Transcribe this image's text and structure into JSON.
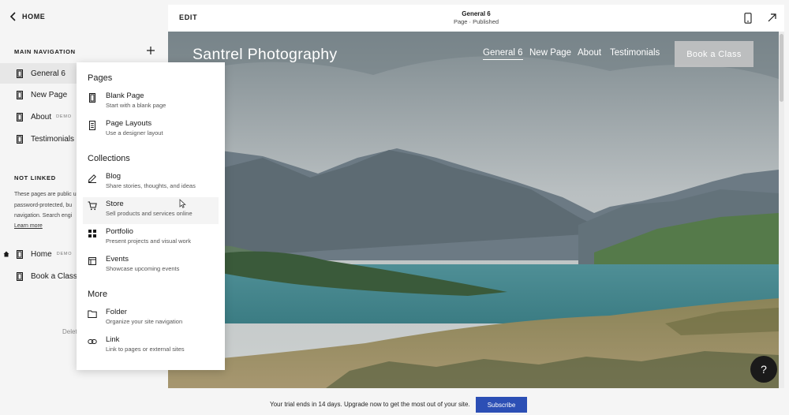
{
  "sidebar": {
    "back_label": "HOME",
    "main_nav_heading": "MAIN NAVIGATION",
    "main_items": [
      {
        "label": "General 6",
        "demo": ""
      },
      {
        "label": "New Page",
        "demo": ""
      },
      {
        "label": "About",
        "demo": "DEMO"
      },
      {
        "label": "Testimonials",
        "demo": ""
      }
    ],
    "not_linked_heading": "NOT LINKED",
    "not_linked_lines": [
      "These pages are public u",
      "password-protected, bu",
      "navigation. Search engi"
    ],
    "learn_more": "Learn more",
    "unlinked_items": [
      {
        "label": "Home",
        "demo": "DEMO"
      },
      {
        "label": "Book a Class",
        "demo": ""
      }
    ],
    "deleted_label": "Delet"
  },
  "dropdown": {
    "sections": [
      {
        "heading": "Pages",
        "items": [
          {
            "title": "Blank Page",
            "desc": "Start with a blank page",
            "icon": "page-icon"
          },
          {
            "title": "Page Layouts",
            "desc": "Use a designer layout",
            "icon": "layout-icon"
          }
        ]
      },
      {
        "heading": "Collections",
        "items": [
          {
            "title": "Blog",
            "desc": "Share stories, thoughts, and ideas",
            "icon": "pen-icon"
          },
          {
            "title": "Store",
            "desc": "Sell products and services online",
            "icon": "cart-icon"
          },
          {
            "title": "Portfolio",
            "desc": "Present projects and visual work",
            "icon": "grid-icon"
          },
          {
            "title": "Events",
            "desc": "Showcase upcoming events",
            "icon": "calendar-icon"
          }
        ]
      },
      {
        "heading": "More",
        "items": [
          {
            "title": "Folder",
            "desc": "Organize your site navigation",
            "icon": "folder-icon"
          },
          {
            "title": "Link",
            "desc": "Link to pages or external sites",
            "icon": "link-icon"
          }
        ]
      }
    ]
  },
  "topbar": {
    "edit_label": "EDIT",
    "page_title": "General 6",
    "page_status": "Page · Published"
  },
  "site": {
    "title": "Santrel Photography",
    "nav": [
      "General 6",
      "New Page",
      "About",
      "Testimonials"
    ],
    "book_button": "Book a Class"
  },
  "help_label": "?",
  "trial": {
    "text": "Your trial ends in 14 days. Upgrade now to get the most out of your site.",
    "subscribe": "Subscribe"
  },
  "colors": {
    "accent": "#2c4fb5",
    "sidebar_bg": "#f5f5f5",
    "active_item": "#e7e7e7"
  }
}
